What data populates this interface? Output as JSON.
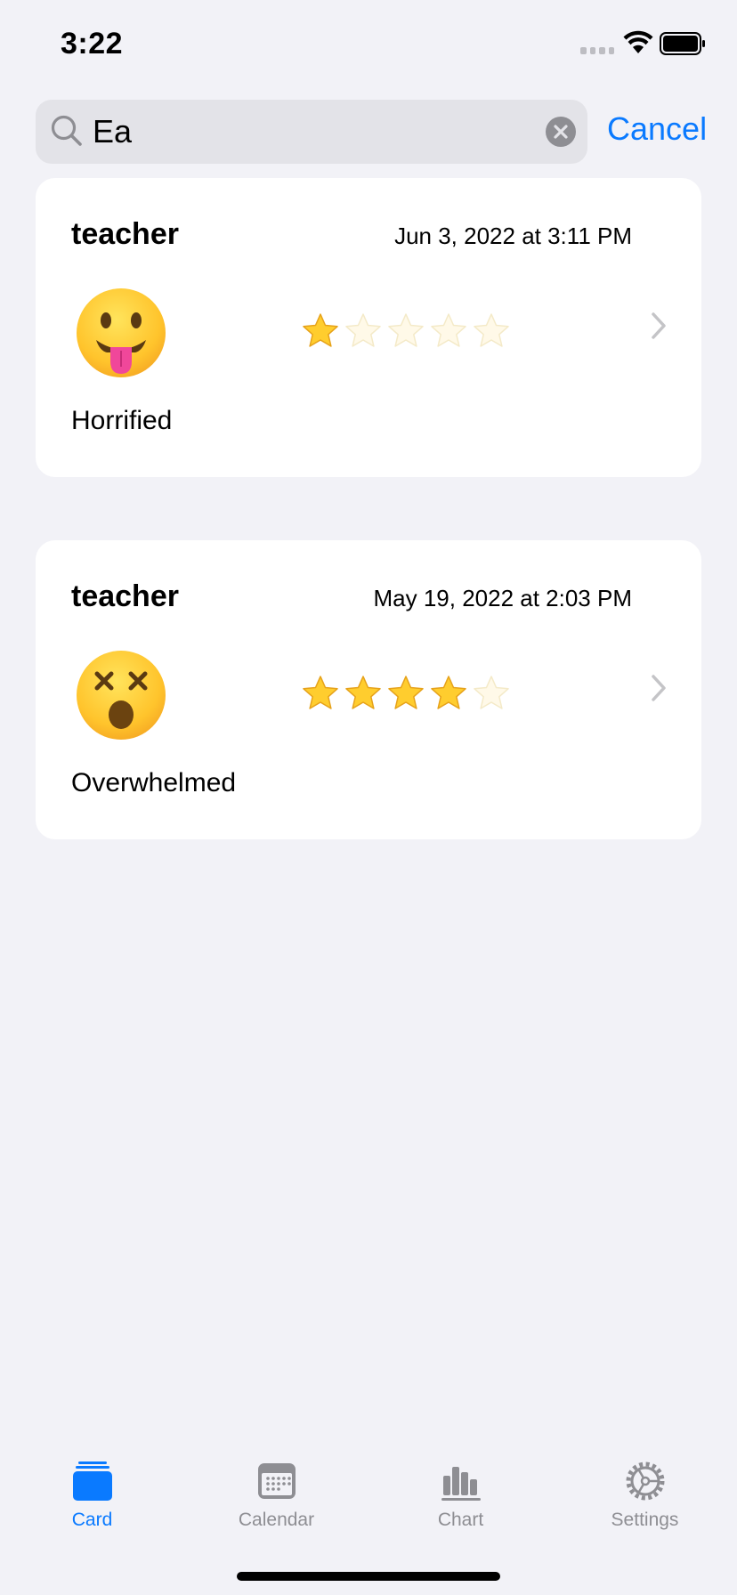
{
  "status_bar": {
    "time": "3:22"
  },
  "search": {
    "value": "Ea",
    "cancel_label": "Cancel"
  },
  "entries": [
    {
      "title": "teacher",
      "date": "Jun 3, 2022 at 3:11 PM",
      "emoji": "face-with-tongue",
      "mood": "Horrified",
      "rating": 1,
      "rating_max": 5
    },
    {
      "title": "teacher",
      "date": "May 19, 2022 at 2:03 PM",
      "emoji": "dizzy-face",
      "mood": "Overwhelmed",
      "rating": 4,
      "rating_max": 5
    }
  ],
  "tab_bar": {
    "tabs": [
      {
        "label": "Card",
        "icon": "cards-icon",
        "active": true
      },
      {
        "label": "Calendar",
        "icon": "calendar-icon",
        "active": false
      },
      {
        "label": "Chart",
        "icon": "bar-chart-icon",
        "active": false
      },
      {
        "label": "Settings",
        "icon": "gear-icon",
        "active": false
      }
    ]
  },
  "colors": {
    "accent": "#0A7AFF",
    "background": "#F2F2F7",
    "card": "#FFFFFF",
    "inactive_tab": "#8E8E93"
  }
}
